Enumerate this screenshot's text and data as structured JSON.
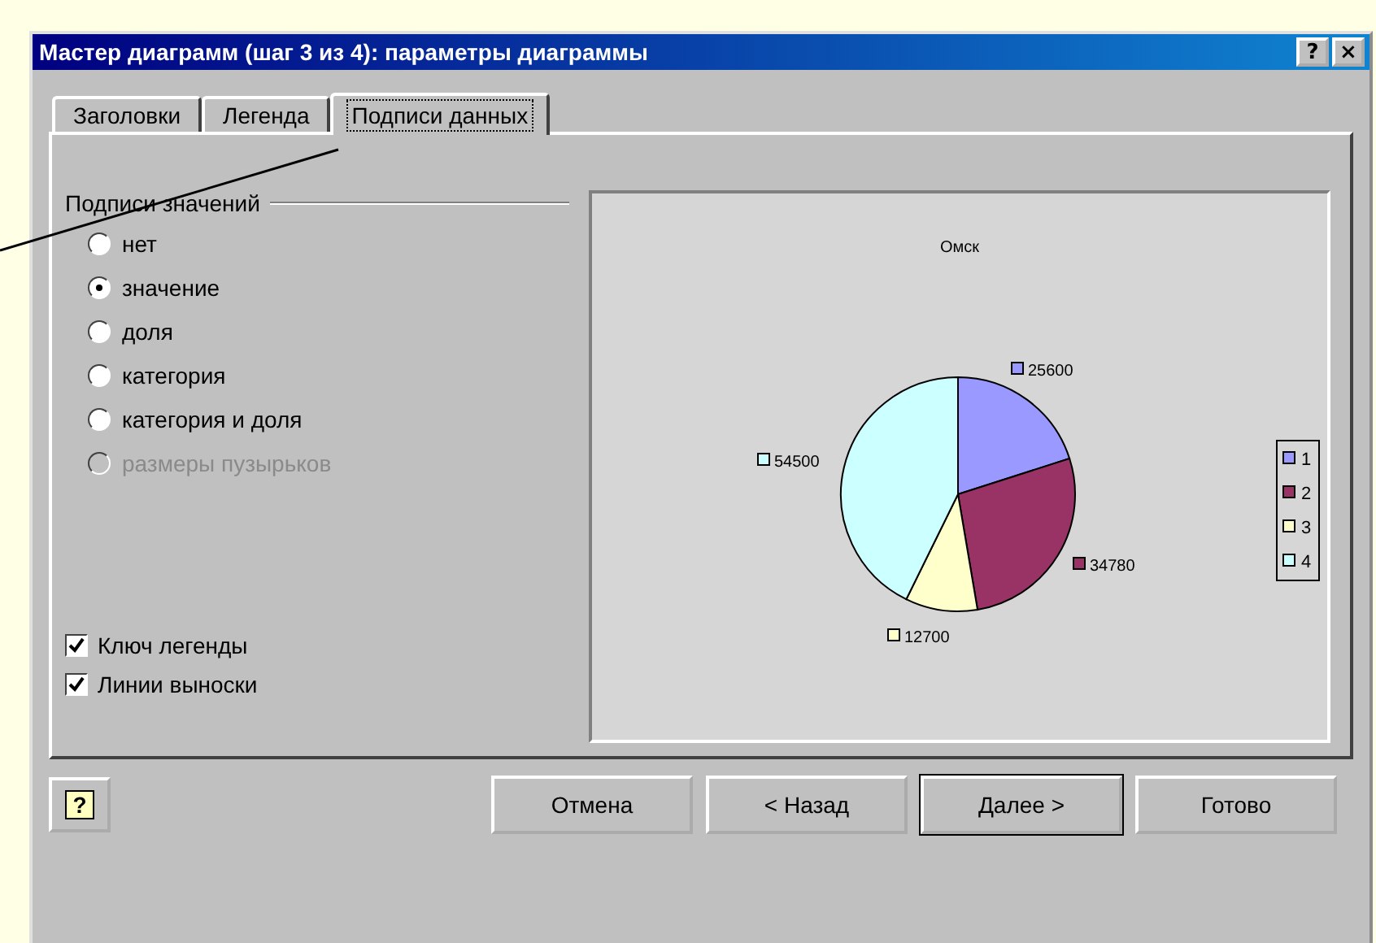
{
  "window": {
    "title": "Мастер диаграмм (шаг 3 из 4): параметры диаграммы",
    "help_button": "?",
    "close_button": "×"
  },
  "tabs": [
    {
      "label": "Заголовки",
      "selected": false
    },
    {
      "label": "Легенда",
      "selected": false
    },
    {
      "label": "Подписи данных",
      "selected": true
    }
  ],
  "value_labels": {
    "title": "Подписи значений",
    "options": [
      {
        "label": "нет",
        "selected": false,
        "disabled": false
      },
      {
        "label": "значение",
        "selected": true,
        "disabled": false
      },
      {
        "label": "доля",
        "selected": false,
        "disabled": false
      },
      {
        "label": "категория",
        "selected": false,
        "disabled": false
      },
      {
        "label": "категория и доля",
        "selected": false,
        "disabled": false
      },
      {
        "label": "размеры пузырьков",
        "selected": false,
        "disabled": true
      }
    ]
  },
  "checkboxes": [
    {
      "label": "Ключ легенды",
      "checked": true
    },
    {
      "label": "Линии выноски",
      "checked": true
    }
  ],
  "preview": {
    "chart_data": {
      "type": "pie",
      "title": "Омск",
      "categories": [
        "1",
        "2",
        "3",
        "4"
      ],
      "series": [
        {
          "colors": [
            "#9999ff",
            "#993366",
            "#ffffcc",
            "#ccffff"
          ],
          "values": [
            25600,
            34780,
            12700,
            54500
          ]
        }
      ],
      "data_labels": true,
      "legend": "right"
    }
  },
  "buttons": [
    {
      "label": "Отмена",
      "default": false
    },
    {
      "label": "< Назад",
      "default": false
    },
    {
      "label": "Далее >",
      "default": true
    },
    {
      "label": "Готово",
      "default": false
    }
  ],
  "help_icon": "?"
}
